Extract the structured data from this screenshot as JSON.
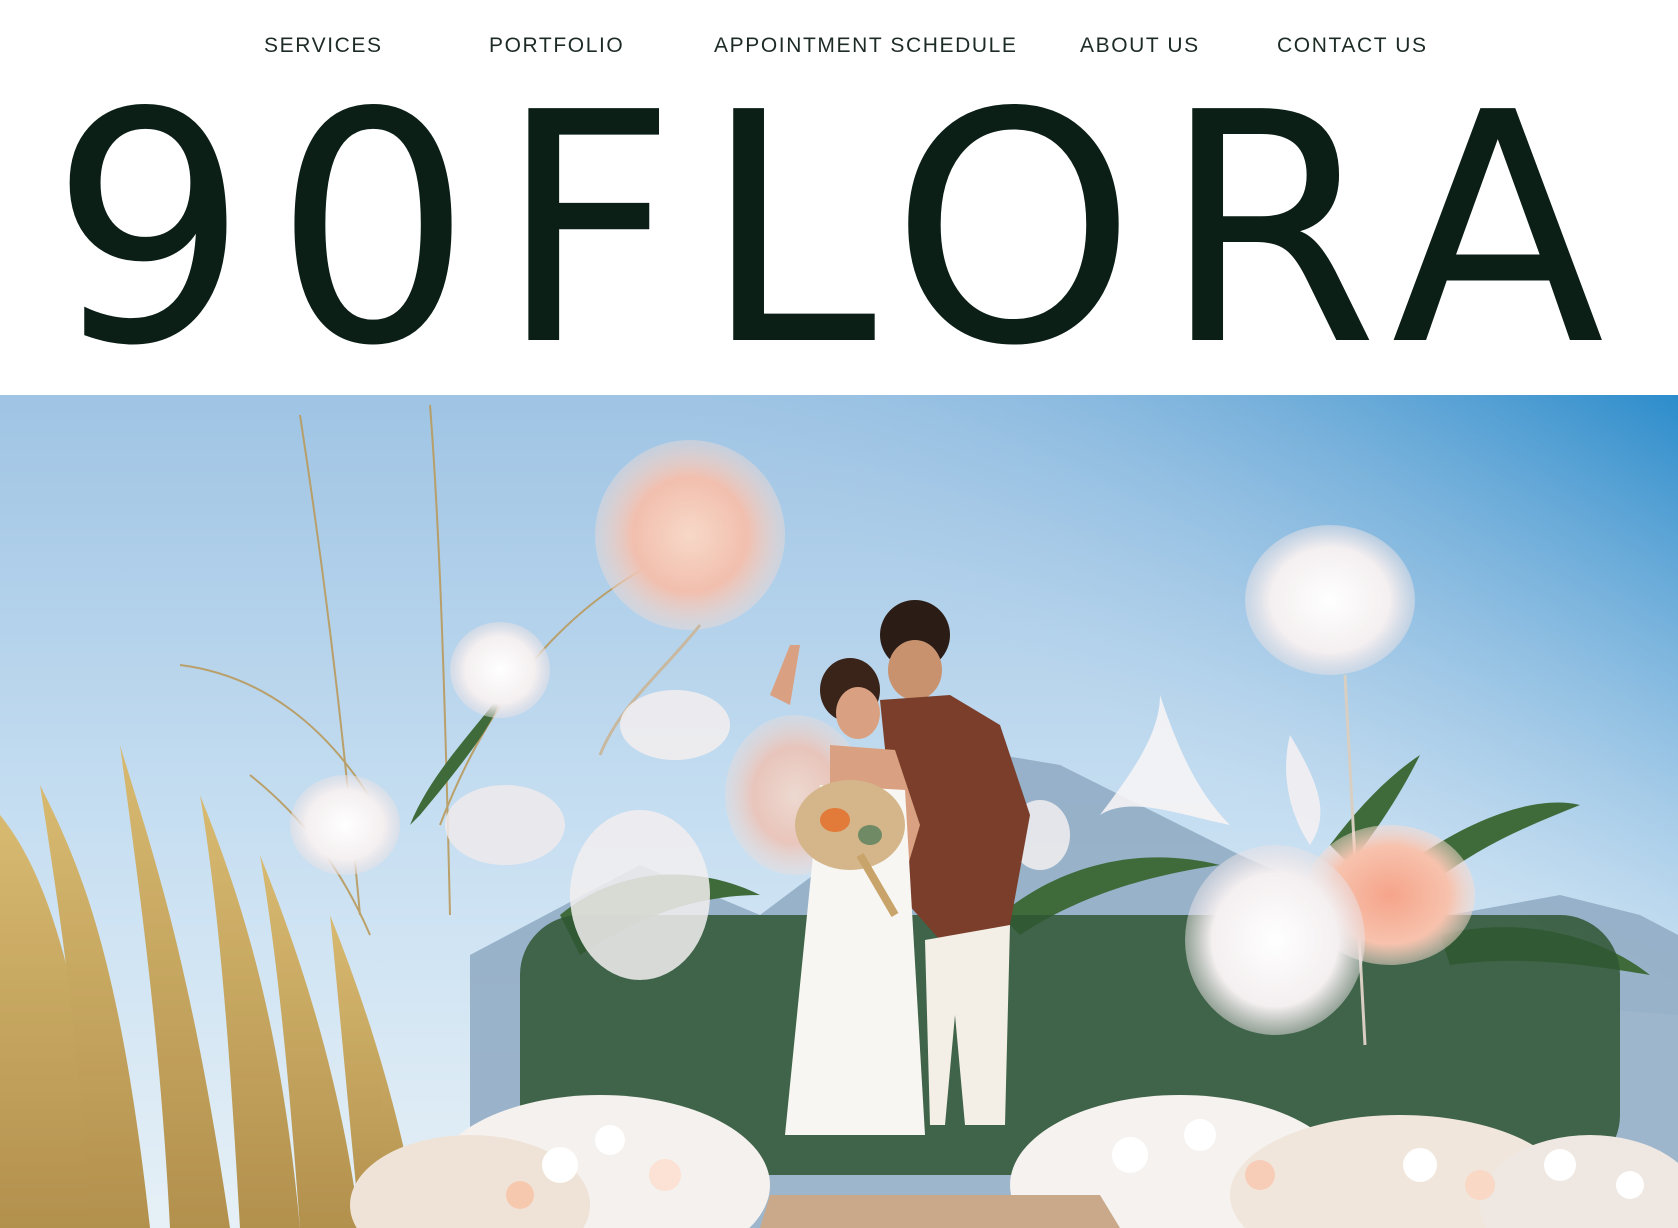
{
  "nav": {
    "items": [
      {
        "label": "SERVICES"
      },
      {
        "label": "PORTFOLIO"
      },
      {
        "label": "APPOINTMENT SCHEDULE"
      },
      {
        "label": "ABOUT US"
      },
      {
        "label": "CONTACT US"
      }
    ]
  },
  "brand": {
    "logo_text": "90FLORA",
    "color": "#0c1f17"
  },
  "hero": {
    "image_subject": "wedding couple among giant paper flowers with mountains",
    "sky_color": "#a9cbe6",
    "accent_peach": "#f4c4b2"
  }
}
